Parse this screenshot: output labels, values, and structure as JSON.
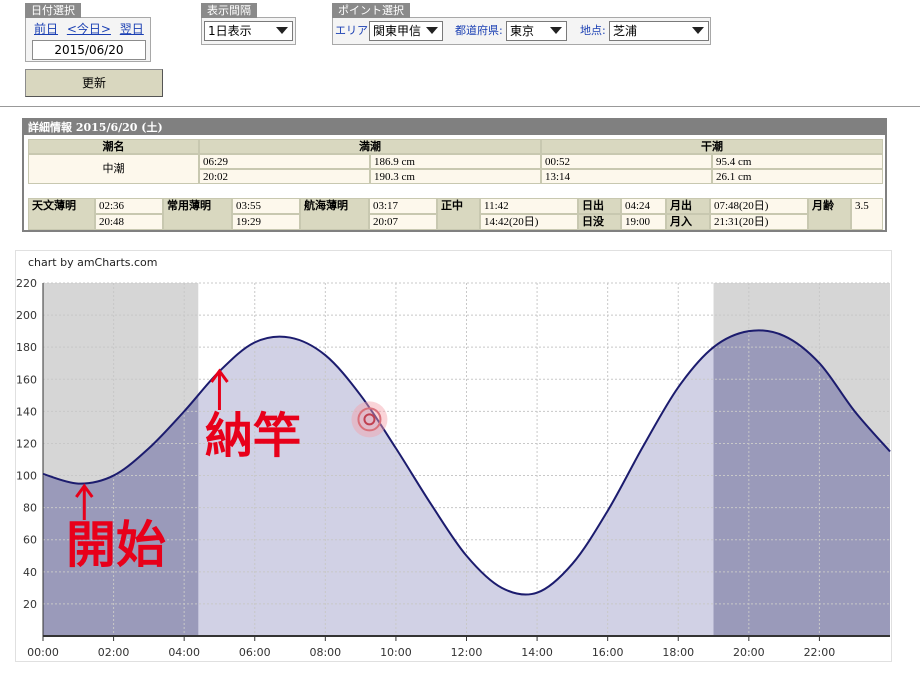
{
  "date_group": {
    "title": "日付選択",
    "prev": "前日",
    "today": "<今日>",
    "next": "翌日",
    "date": "2015/06/20"
  },
  "interval_group": {
    "title": "表示間隔",
    "value": "1日表示"
  },
  "point_group": {
    "title": "ポイント選択",
    "area_label": "エリア:",
    "area": "関東甲信",
    "pref_label": "都道府県:",
    "pref": "東京",
    "place_label": "地点:",
    "place": "芝浦"
  },
  "update_button": "更新",
  "detail": {
    "title": "詳細情報 2015/6/20 (土)",
    "h_tide_name": "潮名",
    "h_high": "満潮",
    "h_low": "干潮",
    "tide_name": "中潮",
    "high": [
      {
        "time": "06:29",
        "height": "186.9 cm"
      },
      {
        "time": "20:02",
        "height": "190.3 cm"
      }
    ],
    "low": [
      {
        "time": "00:52",
        "height": "95.4 cm"
      },
      {
        "time": "13:14",
        "height": "26.1 cm"
      }
    ],
    "astro_label": "天文薄明",
    "astro": [
      "02:36",
      "20:48"
    ],
    "civil_label": "常用薄明",
    "civil": [
      "03:55",
      "19:29"
    ],
    "naut_label": "航海薄明",
    "naut": [
      "03:17",
      "20:07"
    ],
    "noon_label": "正中",
    "noon": [
      "11:42",
      "14:42(20日)"
    ],
    "sunrise_label": "日出",
    "sunrise": "04:24",
    "sunset_label": "日没",
    "sunset": "19:00",
    "moonrise_label": "月出",
    "moonrise": "07:48(20日)",
    "moonset_label": "月入",
    "moonset": "21:31(20日)",
    "moonage_label": "月齢",
    "moonage": "3.5"
  },
  "chart_credit": "chart by amCharts.com",
  "annotations": {
    "start": "開始",
    "end": "納竿"
  },
  "chart_data": {
    "type": "area",
    "x": [
      "00:00",
      "01:00",
      "02:00",
      "03:00",
      "04:00",
      "05:00",
      "06:00",
      "07:00",
      "08:00",
      "09:00",
      "10:00",
      "11:00",
      "12:00",
      "13:00",
      "14:00",
      "15:00",
      "16:00",
      "17:00",
      "18:00",
      "19:00",
      "20:00",
      "21:00",
      "22:00",
      "23:00",
      "24:00"
    ],
    "series": [
      {
        "values": [
          101,
          95,
          100,
          117,
          140,
          165,
          183,
          186,
          175,
          150,
          117,
          82,
          50,
          30,
          27,
          45,
          78,
          118,
          155,
          180,
          190,
          187,
          170,
          140,
          115
        ]
      }
    ],
    "x_ticks": [
      "00:00",
      "02:00",
      "04:00",
      "06:00",
      "08:00",
      "10:00",
      "12:00",
      "14:00",
      "16:00",
      "18:00",
      "20:00",
      "22:00"
    ],
    "y_ticks": [
      20,
      40,
      60,
      80,
      100,
      120,
      140,
      160,
      180,
      200,
      220
    ],
    "ylim": [
      0,
      220
    ],
    "xlim": [
      "00:00",
      "24:00"
    ],
    "night_bands": [
      [
        "00:00",
        "04:24"
      ],
      [
        "19:00",
        "24:00"
      ]
    ],
    "cursor_time": "09:15",
    "cursor_value": 135,
    "line_color": "#1c1c6e",
    "fill_color": "#b3b3d4",
    "night_color": "#d6d6d6",
    "grid": true
  }
}
